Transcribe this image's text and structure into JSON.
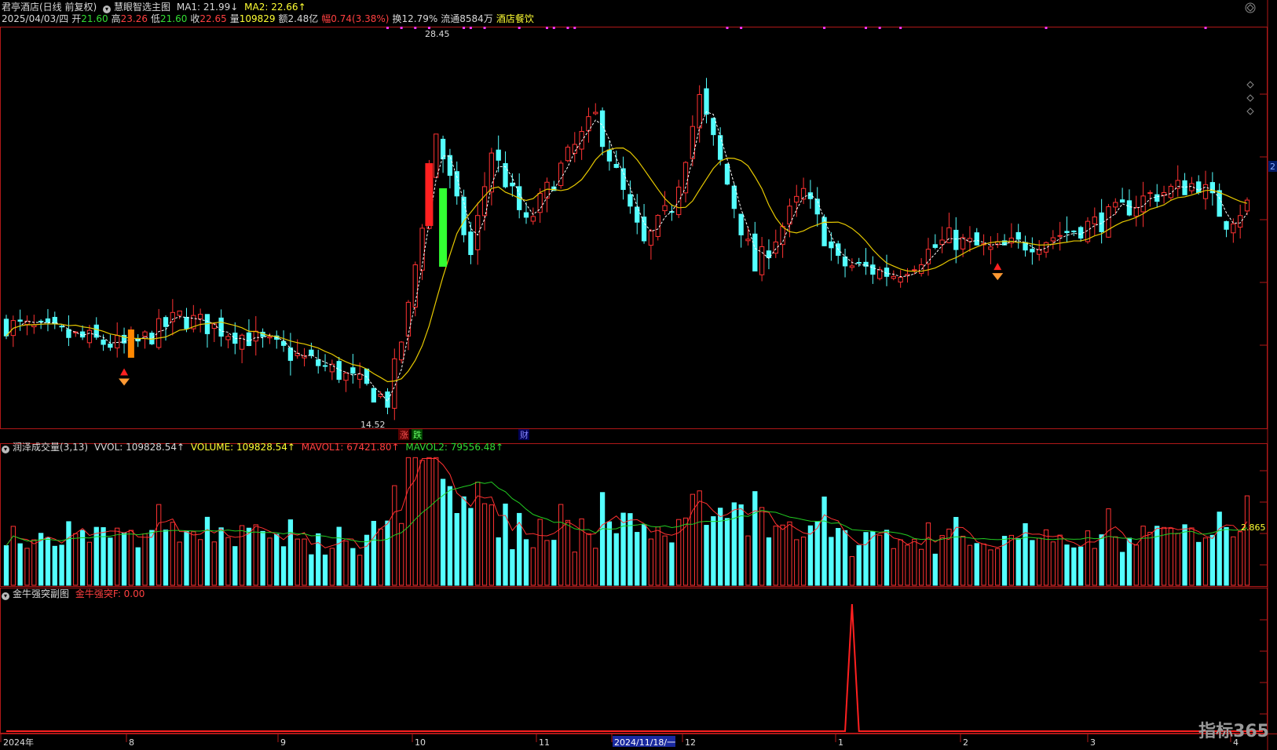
{
  "header": {
    "stock_name": "君亭酒店(日线 前复权)",
    "indicator_name": "慧眼智选主图",
    "ma1_label": "MA1: 21.99↓",
    "ma2_label": "MA2: 22.66↑",
    "date": "2025/04/03/四",
    "open_label": "开",
    "open": "21.60",
    "high_label": "高",
    "high": "23.26",
    "low_label": "低",
    "low": "21.60",
    "close_label": "收",
    "close": "22.65",
    "volume_label": "量",
    "volume": "109829",
    "amount": "额2.48亿",
    "change": "幅0.74(3.38%)",
    "turnover": "换12.79%",
    "float": "流通8584万",
    "sector": "酒店餐饮"
  },
  "vol_panel": {
    "title": "润泽成交量(3,13)",
    "vvol": "VVOL: 109828.54↑",
    "volume": "VOLUME: 109828.54↑",
    "mavol1": "MAVOL1: 67421.80↑",
    "mavol2": "MAVOL2: 79556.48↑",
    "right_value": "2.865"
  },
  "sub_panel": {
    "title": "金牛强突副图",
    "value": "金牛强突F: 0.00"
  },
  "annotations": {
    "high_label": "28.45",
    "low_label": "14.52",
    "rise_tag": "涨",
    "fall_tag": "跌",
    "fin_tag": "财",
    "right_edge_mark": "2"
  },
  "x_axis": {
    "labels": [
      "2024年",
      "8",
      "9",
      "10",
      "11",
      "2024/11/18/一",
      "12",
      "1",
      "2",
      "3",
      "4"
    ]
  },
  "logo": "指标365",
  "colors": {
    "up": "#ff3232",
    "down": "#54ffff",
    "ma1": "#ffffff",
    "ma2": "#e6c800",
    "mavol1": "#ff3030",
    "mavol2": "#22cc22",
    "frame": "#b01818"
  },
  "chart_data": {
    "type": "candlestick",
    "title": "君亭酒店(日线 前复权)",
    "ylim": [
      13.8,
      29.6
    ],
    "x_count": 180,
    "keypoints_x_index": [
      0,
      18,
      25,
      35,
      48,
      55,
      58,
      62,
      67,
      70,
      75,
      80,
      85,
      90,
      92,
      96,
      100,
      108,
      115,
      120,
      128,
      136,
      142,
      150,
      158,
      165,
      172,
      176,
      179
    ],
    "keypoints_price": [
      17.9,
      17.0,
      18.2,
      17.4,
      16.0,
      14.9,
      18.5,
      25.5,
      20.6,
      24.8,
      21.8,
      24.1,
      26.1,
      22.3,
      21.0,
      22.6,
      26.8,
      20.1,
      23.1,
      20.3,
      19.9,
      21.3,
      20.8,
      21.3,
      22.0,
      23.0,
      23.5,
      22.0,
      22.65
    ],
    "ma_lines": [
      "MA1",
      "MA2"
    ],
    "volume_ylim": [
      0,
      160000
    ],
    "last_volume": 109828.54,
    "mavol1": 67421.8,
    "mavol2": 79556.48,
    "signal_spike_index": 122
  }
}
